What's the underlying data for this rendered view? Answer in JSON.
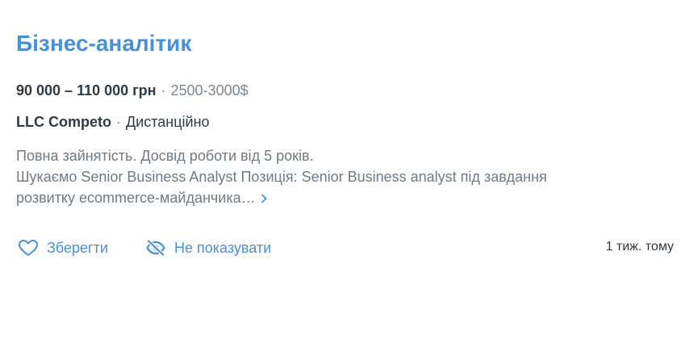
{
  "vacancy": {
    "title": "Бізнес-аналітик",
    "salary_uah": "90 000 – 110 000 грн",
    "separator": "·",
    "salary_usd": "2500-3000$",
    "company": "LLC Competo",
    "location": "Дистанційно",
    "description_line1": "Повна зайнятість. Досвід роботи від 5 років.",
    "description_line2": "Шукаємо Senior Business Analyst Позиція: Senior Business analyst під завдання",
    "description_line3": "розвитку ecommerce-майданчика…",
    "posted": "1 тиж. тому"
  },
  "actions": {
    "save_label": "Зберегти",
    "hide_label": "Не показувати"
  },
  "icons": {
    "save": "heart-icon",
    "hide": "eye-slash-icon",
    "more": "chevron-right-icon"
  },
  "colors": {
    "accent": "#4a90d6",
    "text": "#303a44",
    "muted": "#6f7a84"
  }
}
